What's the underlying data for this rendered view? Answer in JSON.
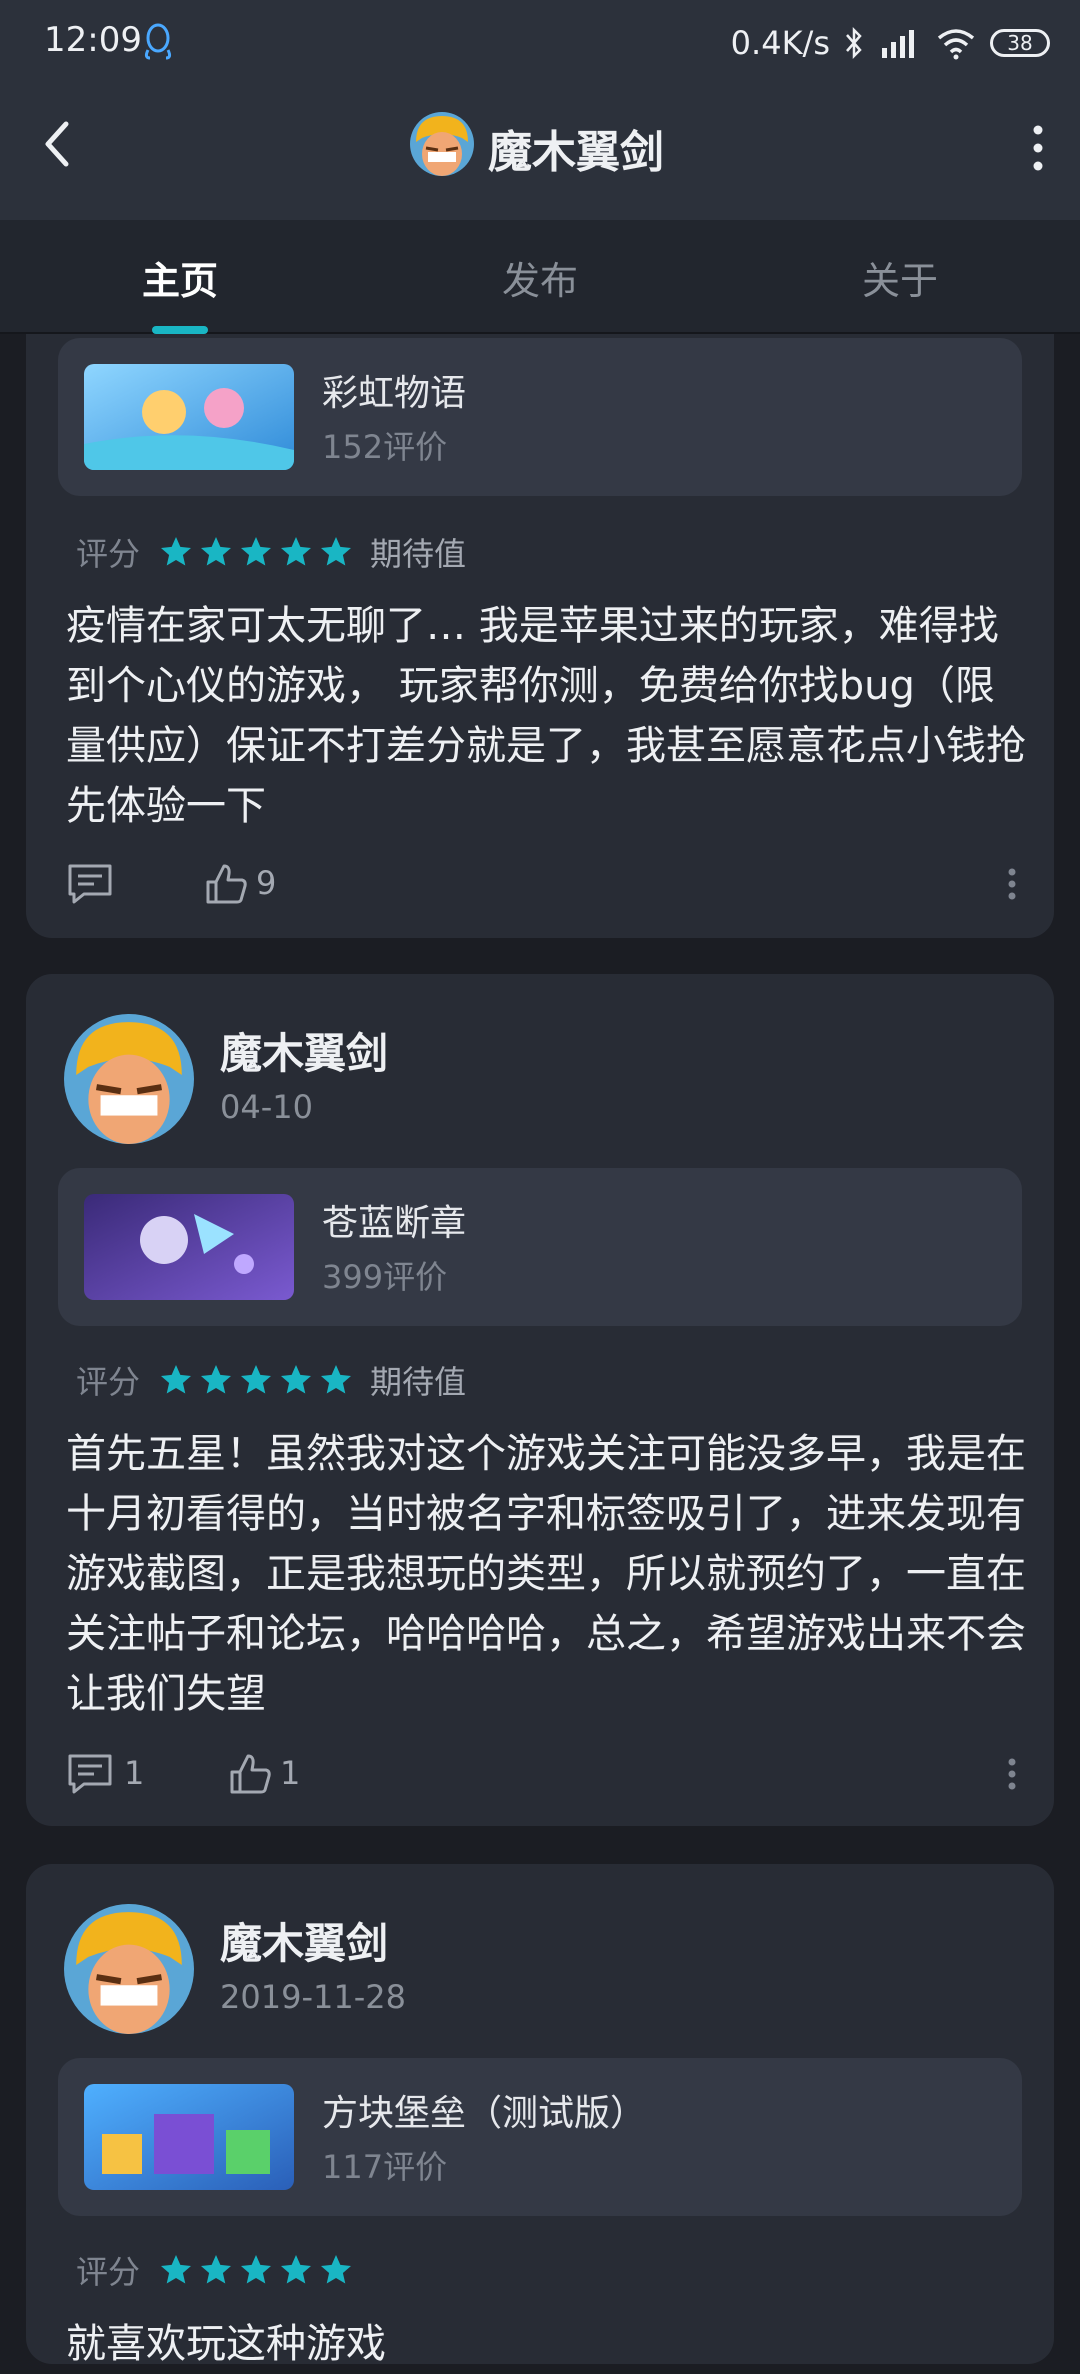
{
  "status_bar": {
    "time": "12:09",
    "network_speed": "0.4K/s",
    "battery": "38"
  },
  "header": {
    "title": "魔木翼剑"
  },
  "tabs": [
    {
      "label": "主页",
      "active": true
    },
    {
      "label": "发布",
      "active": false
    },
    {
      "label": "关于",
      "active": false
    }
  ],
  "colors": {
    "accent": "#19b6c4",
    "background": "#1b1d23",
    "card": "#282c35"
  },
  "posts": [
    {
      "game": {
        "name": "彩虹物语",
        "reviews": "152评价"
      },
      "rating_label": "评分",
      "stars": 5,
      "rating_note": "期待值",
      "text": "疫情在家可太无聊了… 我是苹果过来的玩家，难得找到个心仪的游戏， 玩家帮你测，免费给你找bug（限量供应）保证不打差分就是了，我甚至愿意花点小钱抢先体验一下",
      "comments": "",
      "likes": "9"
    },
    {
      "author": "魔木翼剑",
      "date": "04-10",
      "game": {
        "name": "苍蓝断章",
        "reviews": "399评价"
      },
      "rating_label": "评分",
      "stars": 5,
      "rating_note": "期待值",
      "text": "首先五星！虽然我对这个游戏关注可能没多早，我是在十月初看得的，当时被名字和标签吸引了，进来发现有游戏截图，正是我想玩的类型，所以就预约了，一直在关注帖子和论坛，哈哈哈哈，总之，希望游戏出来不会让我们失望",
      "comments": "1",
      "likes": "1"
    },
    {
      "author": "魔木翼剑",
      "date": "2019-11-28",
      "game": {
        "name": "方块堡垒（测试版）",
        "reviews": "117评价"
      },
      "rating_label": "评分",
      "stars": 5,
      "text": "就喜欢玩这种游戏"
    }
  ]
}
